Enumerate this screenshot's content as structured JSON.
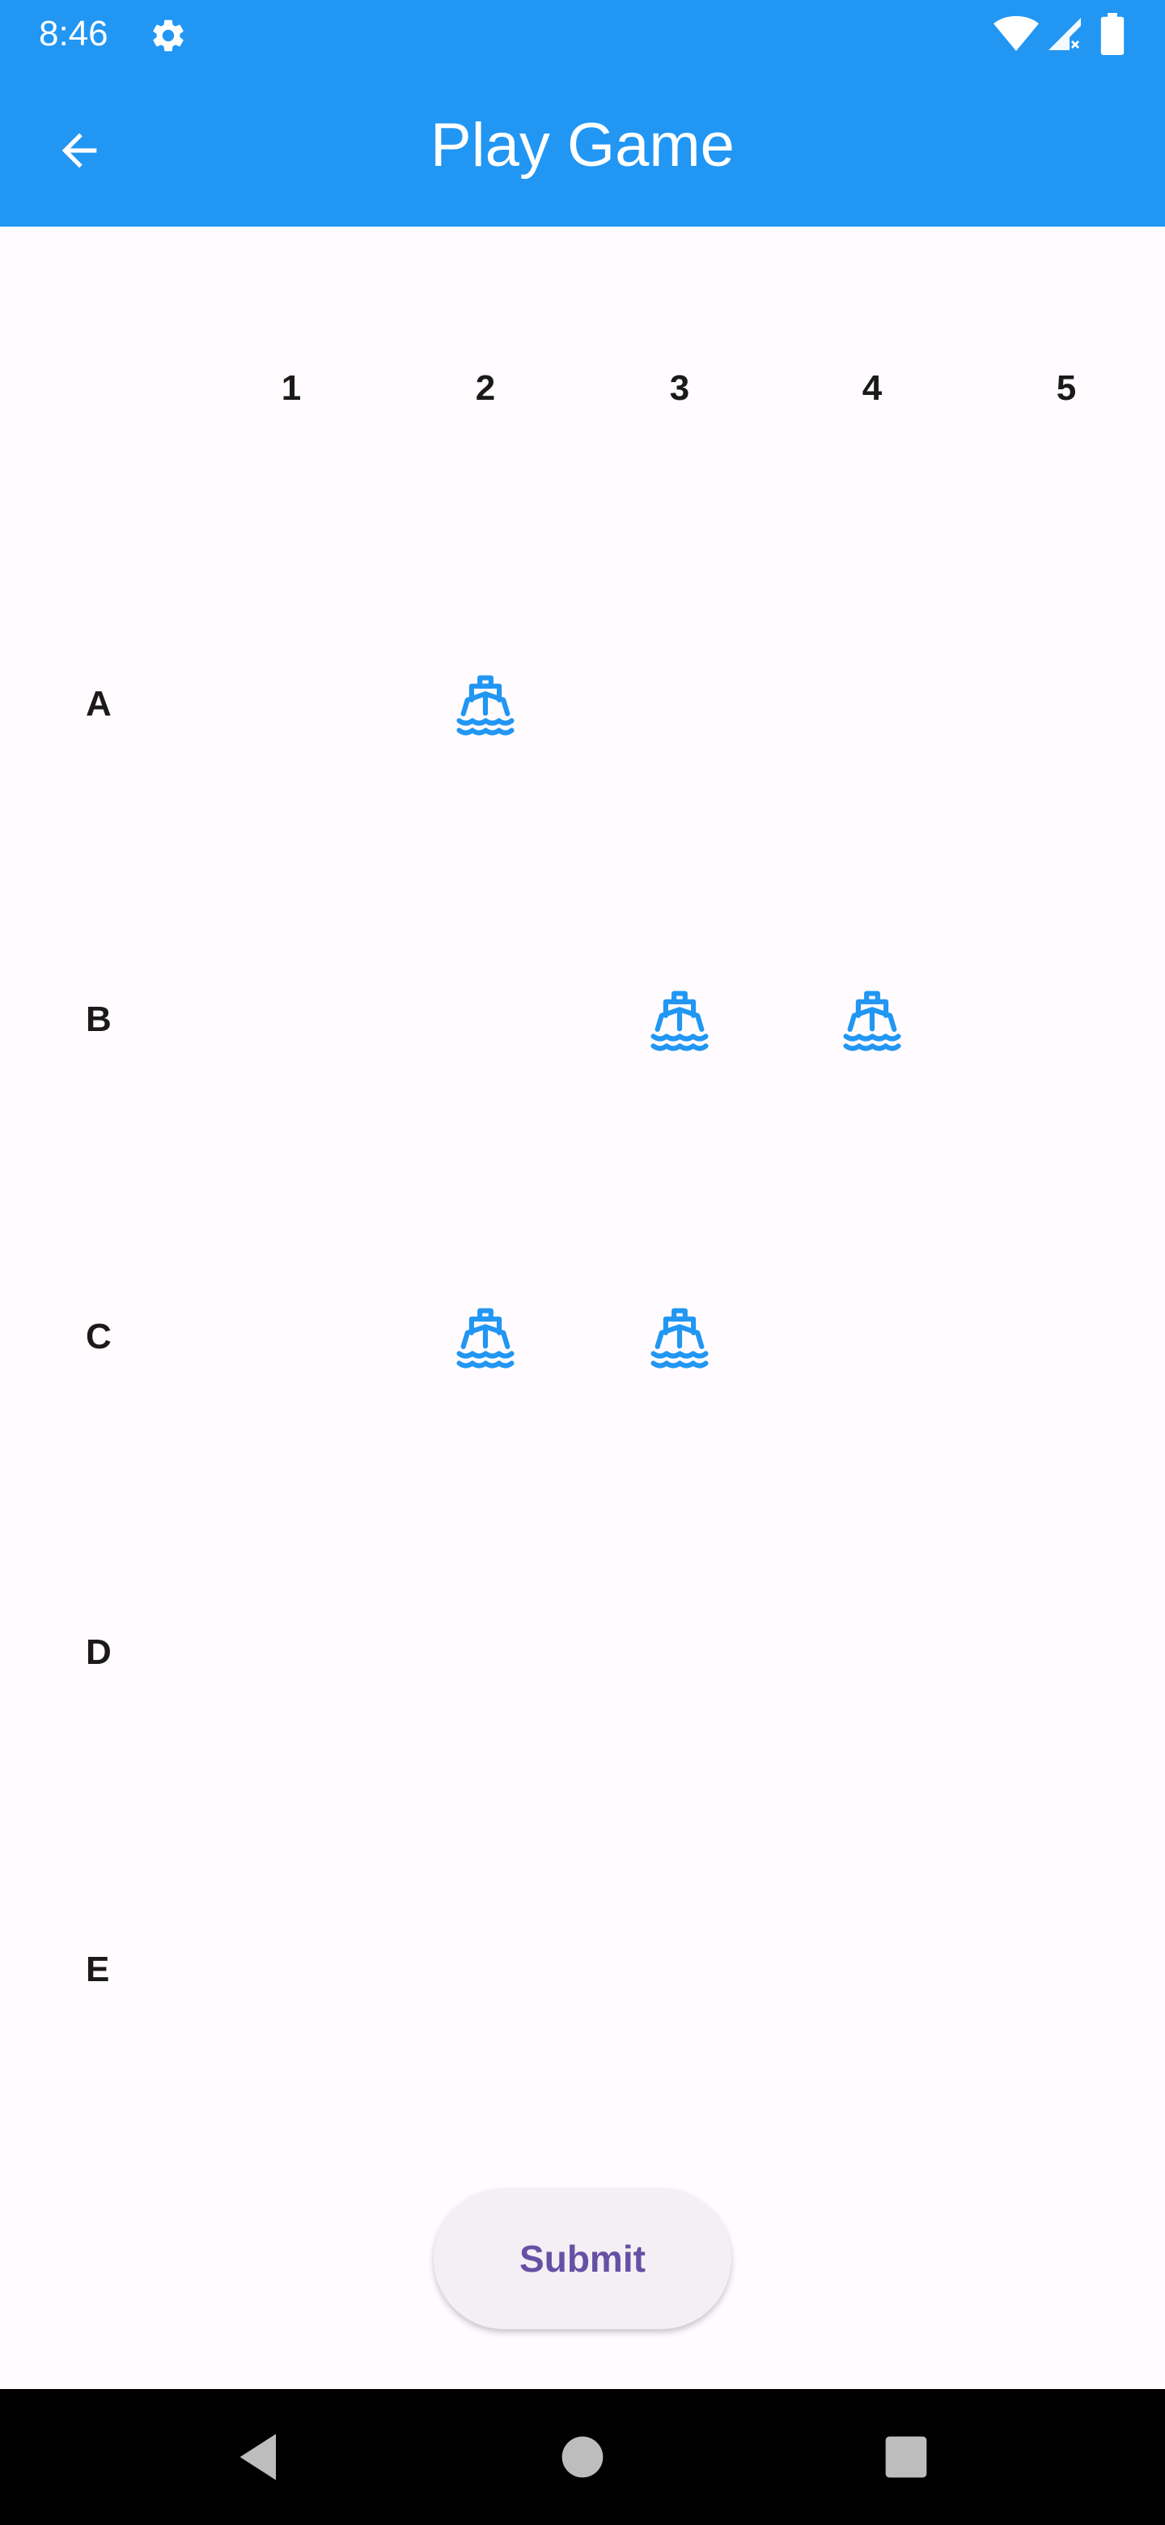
{
  "status_bar": {
    "time": "8:46",
    "icons": [
      "gear-icon",
      "wifi-icon",
      "signal-icon",
      "battery-icon"
    ]
  },
  "app_bar": {
    "title": "Play Game",
    "back_icon": "arrow-left-icon",
    "background_color": "#2196f3"
  },
  "board": {
    "columns": [
      "1",
      "2",
      "3",
      "4",
      "5"
    ],
    "rows": [
      "A",
      "B",
      "C",
      "D",
      "E"
    ],
    "ship_icon": "ship-icon",
    "ship_color": "#2196f3",
    "ships": [
      {
        "row": "A",
        "col": "2"
      },
      {
        "row": "B",
        "col": "3"
      },
      {
        "row": "B",
        "col": "4"
      },
      {
        "row": "C",
        "col": "2"
      },
      {
        "row": "C",
        "col": "3"
      }
    ]
  },
  "submit": {
    "label": "Submit",
    "text_color": "#6750a4"
  },
  "nav_bar": {
    "icons": [
      "nav-back-icon",
      "nav-home-icon",
      "nav-recents-icon"
    ]
  }
}
